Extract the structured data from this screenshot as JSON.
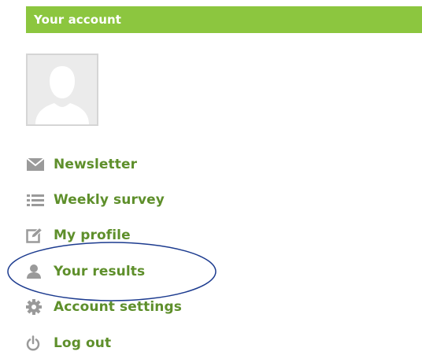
{
  "header": {
    "title": "Your account"
  },
  "account": {
    "avatar_icon": "default-user-avatar"
  },
  "menu": {
    "items": [
      {
        "label": "Newsletter",
        "icon": "envelope-icon"
      },
      {
        "label": "Weekly survey",
        "icon": "list-icon"
      },
      {
        "label": "My profile",
        "icon": "edit-icon"
      },
      {
        "label": "Your results",
        "icon": "user-icon"
      },
      {
        "label": "Account settings",
        "icon": "gear-icon"
      },
      {
        "label": "Log out",
        "icon": "power-icon"
      }
    ]
  },
  "colors": {
    "header_bg": "#8cc63f",
    "header_text": "#ffffff",
    "link_text": "#5e8f2b",
    "icon_gray": "#9a9a9a",
    "highlight_ring": "#1c3b8f"
  }
}
